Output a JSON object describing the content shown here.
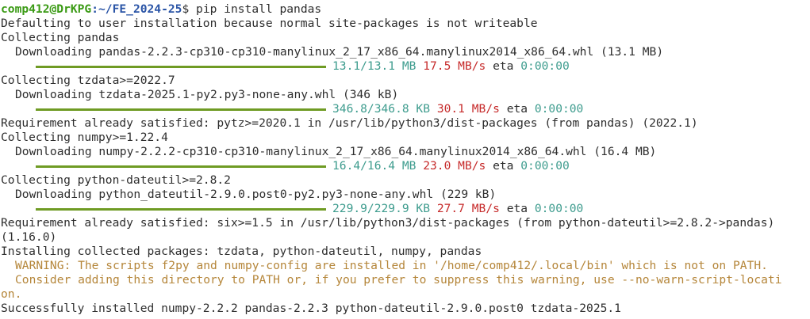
{
  "prompt": {
    "user_host": "comp412@DrKPG",
    "path": ":~/FE_2024-25",
    "command": "$ pip install pandas"
  },
  "lines": {
    "l2": "Defaulting to user installation because normal site-packages is not writeable",
    "l3": "Collecting pandas",
    "l4": "Downloading pandas-2.2.3-cp310-cp310-manylinux_2_17_x86_64.manylinux2014_x86_64.whl (13.1 MB)",
    "l6": "Collecting tzdata>=2022.7",
    "l7": "Downloading tzdata-2025.1-py2.py3-none-any.whl (346 kB)",
    "l9": "Requirement already satisfied: pytz>=2020.1 in /usr/lib/python3/dist-packages (from pandas) (2022.1)",
    "l10": "Collecting numpy>=1.22.4",
    "l11": "Downloading numpy-2.2.2-cp310-cp310-manylinux_2_17_x86_64.manylinux2014_x86_64.whl (16.4 MB)",
    "l13": "Collecting python-dateutil>=2.8.2",
    "l14": "Downloading python_dateutil-2.9.0.post0-py2.py3-none-any.whl (229 kB)",
    "l16": "Requirement already satisfied: six>=1.5 in /usr/lib/python3/dist-packages (from python-dateutil>=2.8.2->pandas)",
    "l17": "(1.16.0)",
    "l18": "Installing collected packages: tzdata, python-dateutil, numpy, pandas",
    "l19": "WARNING: The scripts f2py and numpy-config are installed in '/home/comp412/.local/bin' which is not on PATH.",
    "l20": "Consider adding this directory to PATH or, if you prefer to suppress this warning, use --no-warn-script-locati",
    "l21": "on.",
    "l22": "Successfully installed numpy-2.2.2 pandas-2.2.3 python-dateutil-2.9.0.post0 tzdata-2025.1"
  },
  "progress": {
    "pandas": {
      "size": "13.1/13.1 MB",
      "speed": "17.5 MB/s",
      "eta": "eta",
      "eta_time": "0:00:00",
      "fraction": 1.0
    },
    "tzdata": {
      "size": "346.8/346.8 KB",
      "speed": "30.1 MB/s",
      "eta": "eta",
      "eta_time": "0:00:00",
      "fraction": 1.0
    },
    "numpy": {
      "size": "16.4/16.4 MB",
      "speed": "23.0 MB/s",
      "eta": "eta",
      "eta_time": "0:00:00",
      "fraction": 1.0
    },
    "dateutil": {
      "size": "229.9/229.9 KB",
      "speed": "27.7 MB/s",
      "eta": "eta",
      "eta_time": "0:00:00",
      "fraction": 1.0
    }
  },
  "colors": {
    "prompt_user": "#3a9a14",
    "prompt_path": "#2a54a6",
    "progress_bar": "#6f9b24",
    "size_text": "#3e9c8e",
    "speed_text": "#c62a2a",
    "warning_text": "#b5863a"
  }
}
